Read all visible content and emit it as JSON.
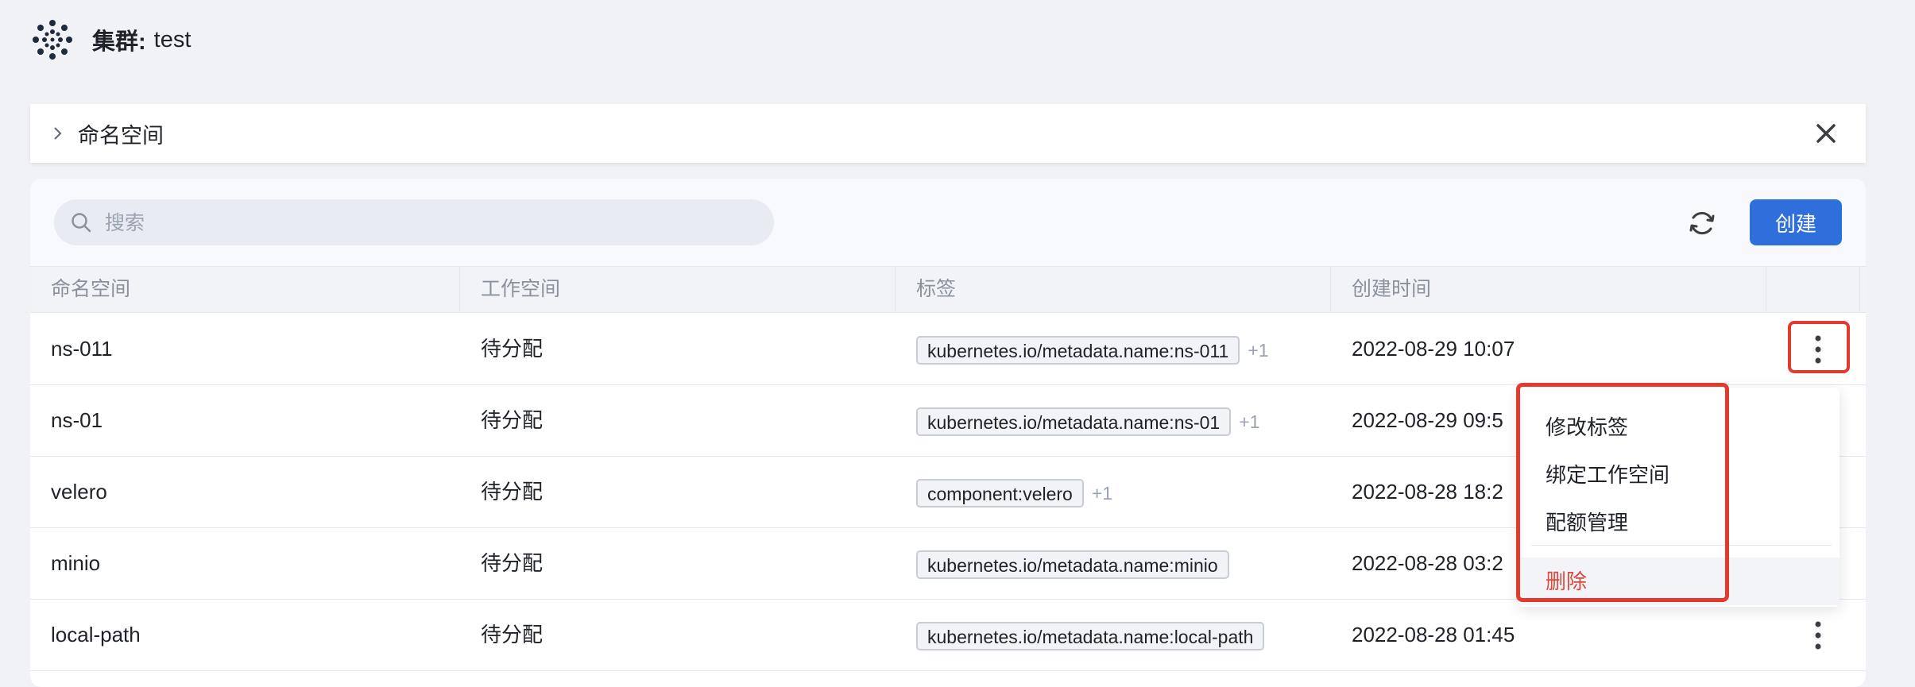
{
  "header": {
    "cluster_label": "集群:",
    "cluster_name": "test"
  },
  "namespace_bar": {
    "title": "命名空间"
  },
  "toolbar": {
    "search_placeholder": "搜索",
    "create_label": "创建"
  },
  "table": {
    "columns": [
      "命名空间",
      "工作空间",
      "标签",
      "创建时间"
    ],
    "rows": [
      {
        "name": "ns-011",
        "workspace": "待分配",
        "tag": "kubernetes.io/metadata.name:ns-011",
        "extra": "+1",
        "created": "2022-08-29 10:07"
      },
      {
        "name": "ns-01",
        "workspace": "待分配",
        "tag": "kubernetes.io/metadata.name:ns-01",
        "extra": "+1",
        "created": "2022-08-29 09:5"
      },
      {
        "name": "velero",
        "workspace": "待分配",
        "tag": "component:velero",
        "extra": "+1",
        "created": "2022-08-28 18:2"
      },
      {
        "name": "minio",
        "workspace": "待分配",
        "tag": "kubernetes.io/metadata.name:minio",
        "extra": "",
        "created": "2022-08-28 03:2"
      },
      {
        "name": "local-path",
        "workspace": "待分配",
        "tag": "kubernetes.io/metadata.name:local-path",
        "extra": "",
        "created": "2022-08-28 01:45"
      }
    ]
  },
  "menu": {
    "items": [
      "修改标签",
      "绑定工作空间",
      "配额管理"
    ],
    "danger": "删除"
  },
  "colors": {
    "primary": "#2f6fdb",
    "danger": "#e0473b",
    "highlight": "#e23b2e"
  }
}
